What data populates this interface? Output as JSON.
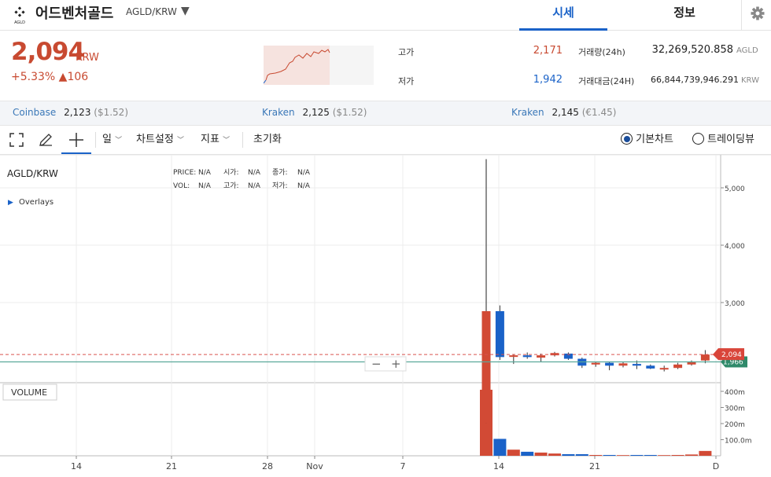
{
  "header": {
    "coin_name": "어드벤처골드",
    "pair": "AGLD/KRW",
    "logo_text": "AGLD",
    "tabs": [
      {
        "label": "시세"
      },
      {
        "label": "정보"
      }
    ]
  },
  "price": {
    "current": "2,094",
    "unit": "KRW",
    "change_percent": "+5.33%",
    "change_amount": "▲106"
  },
  "stats": {
    "high_label": "고가",
    "high": "2,171",
    "low_label": "저가",
    "low": "1,942",
    "volume_label": "거래량(24h)",
    "volume": "32,269,520.858",
    "volume_unit": "AGLD",
    "amount_label": "거래대금(24H)",
    "amount": "66,844,739,946.291",
    "amount_unit": "KRW"
  },
  "exchanges": [
    {
      "name": "Coinbase",
      "price": "2,123",
      "alt": "($1.52)"
    },
    {
      "name": "Kraken",
      "price": "2,125",
      "alt": "($1.52)"
    },
    {
      "name": "Kraken",
      "price": "2,145",
      "alt": "(€1.45)"
    }
  ],
  "toolbar": {
    "interval": "일",
    "chart_settings": "차트설정",
    "indicators": "지표",
    "reset": "초기화",
    "view_basic": "기본차트",
    "view_tradingview": "트레이딩뷰"
  },
  "chart_info": {
    "symbol": "AGLD/KRW",
    "overlays": "Overlays",
    "price_label": "PRICE:",
    "price_val": "N/A",
    "vol_label": "VOL:",
    "vol_val": "N/A",
    "open_label": "시가:",
    "open_val": "N/A",
    "high_label": "고가:",
    "high_val": "N/A",
    "close_label": "종가:",
    "close_val": "N/A",
    "low_label": "저가:",
    "low_val": "N/A",
    "volume_panel": "VOLUME",
    "zoom_out": "−",
    "zoom_in": "+",
    "current_price_tag": "2,094",
    "ref_price_tag": "1,966"
  },
  "chart_data": {
    "type": "candlestick",
    "y_ticks": [
      "5,000",
      "4,000",
      "3,000"
    ],
    "y_tick_values": [
      5000,
      4000,
      3000
    ],
    "volume_ticks": [
      "400m",
      "300m",
      "200m",
      "100.0m"
    ],
    "volume_tick_values": [
      400,
      300,
      200,
      100
    ],
    "x_ticks": [
      "14",
      "21",
      "28",
      "Nov",
      "7",
      "14",
      "21",
      "D"
    ],
    "candles": [
      {
        "o": 900,
        "c": 2850,
        "h": 5500,
        "l": 900
      },
      {
        "o": 2850,
        "c": 2050,
        "h": 2950,
        "l": 2000
      },
      {
        "o": 2060,
        "c": 2080,
        "h": 2100,
        "l": 1930
      },
      {
        "o": 2080,
        "c": 2050,
        "h": 2130,
        "l": 2020
      },
      {
        "o": 2040,
        "c": 2080,
        "h": 2110,
        "l": 1960
      },
      {
        "o": 2080,
        "c": 2120,
        "h": 2140,
        "l": 2060
      },
      {
        "o": 2110,
        "c": 2020,
        "h": 2130,
        "l": 2000
      },
      {
        "o": 2020,
        "c": 1900,
        "h": 2040,
        "l": 1860
      },
      {
        "o": 1920,
        "c": 1950,
        "h": 1970,
        "l": 1880
      },
      {
        "o": 1950,
        "c": 1900,
        "h": 1970,
        "l": 1820
      },
      {
        "o": 1900,
        "c": 1940,
        "h": 1960,
        "l": 1870
      },
      {
        "o": 1930,
        "c": 1900,
        "h": 1990,
        "l": 1840
      },
      {
        "o": 1900,
        "c": 1850,
        "h": 1920,
        "l": 1840
      },
      {
        "o": 1840,
        "c": 1860,
        "h": 1900,
        "l": 1800
      },
      {
        "o": 1860,
        "c": 1920,
        "h": 1950,
        "l": 1840
      },
      {
        "o": 1920,
        "c": 1970,
        "h": 1990,
        "l": 1900
      },
      {
        "o": 1990,
        "c": 2094,
        "h": 2171,
        "l": 1942
      }
    ],
    "volumes": [
      410,
      105,
      38,
      25,
      20,
      14,
      10,
      10,
      5,
      5,
      4,
      5,
      5,
      4,
      5,
      8,
      30
    ],
    "current_price": 2094,
    "ref_price": 1966
  }
}
